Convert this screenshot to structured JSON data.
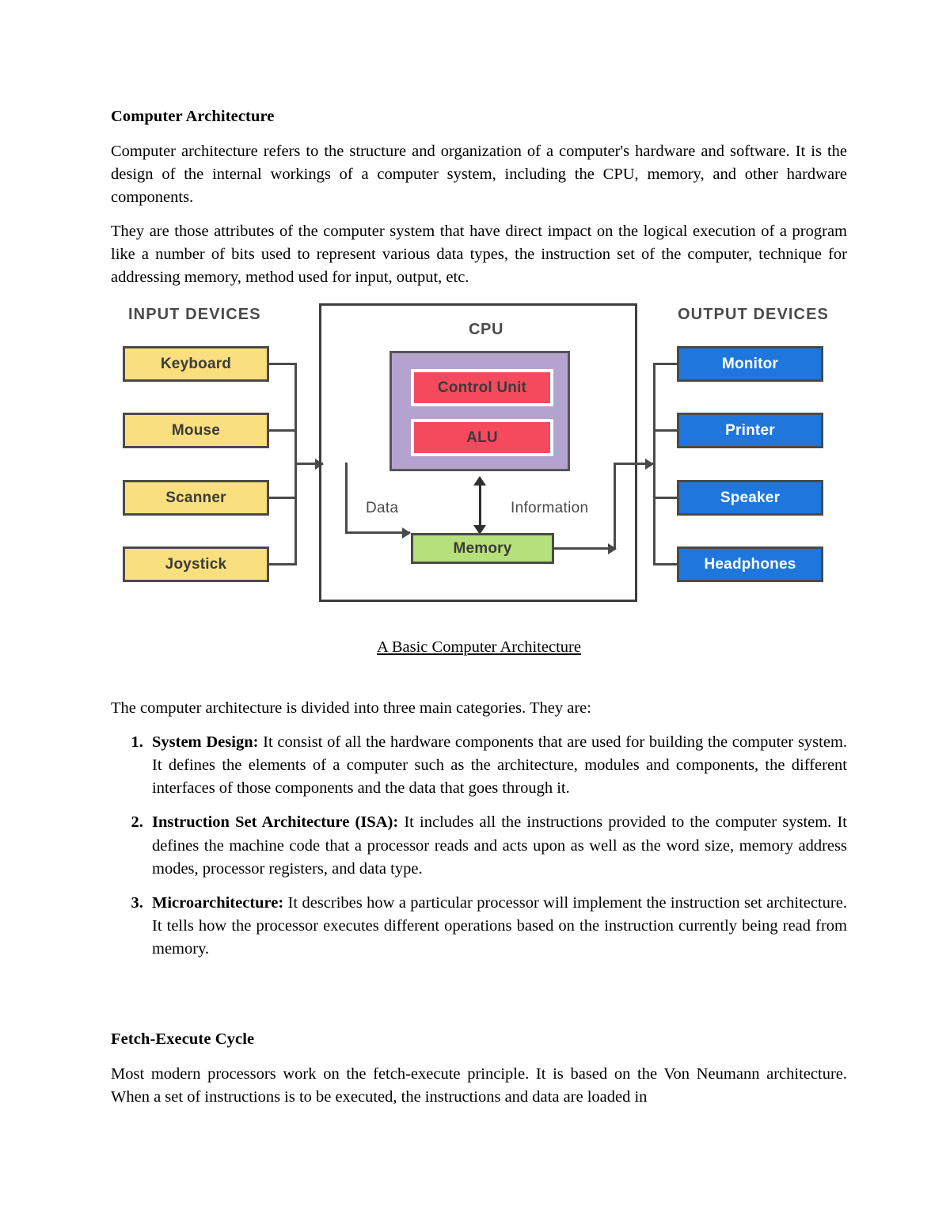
{
  "document": {
    "heading": "Computer Architecture",
    "paragraphs": [
      "Computer architecture refers to the structure and organization of a computer's hardware and software. It is the design of the internal workings of a computer system, including the CPU, memory, and other hardware components.",
      "They are those attributes of the computer system that have direct impact on the logical execution of a program like a number of bits used to represent various data types, the instruction set of the computer, technique for addressing memory, method used for input, output, etc."
    ],
    "figure_caption": "A Basic Computer Architecture",
    "list_intro": "The computer architecture is divided into three main categories. They are:",
    "categories": [
      {
        "term": "System Design:",
        "text": " It consist of all the hardware components that are used for building the computer system. It defines the elements of a computer such as the architecture, modules and components, the different interfaces of those components and the data that goes through it."
      },
      {
        "term": "Instruction Set Architecture (ISA):",
        "text": " It includes all the instructions provided to the computer system. It defines the machine code that a processor reads and acts upon as well as the word size, memory address modes, processor registers, and data type."
      },
      {
        "term": "Microarchitecture:",
        "text": " It describes how a particular processor will implement the instruction set architecture. It tells how the processor executes different operations based on the instruction currently being read from memory."
      }
    ],
    "section2_heading": "Fetch-Execute Cycle",
    "section2_paragraph": "Most modern processors work on the fetch-execute principle. It is based on the Von Neumann architecture.  When a set of instructions is to be executed, the instructions and data are loaded in"
  },
  "diagram": {
    "input_title": "INPUT DEVICES",
    "output_title": "OUTPUT DEVICES",
    "cpu_label": "CPU",
    "input_devices": [
      "Keyboard",
      "Mouse",
      "Scanner",
      "Joystick"
    ],
    "output_devices": [
      "Monitor",
      "Printer",
      "Speaker",
      "Headphones"
    ],
    "cpu_units": [
      "Control Unit",
      "ALU"
    ],
    "memory_label": "Memory",
    "flow_left_label": "Data",
    "flow_right_label": "Information",
    "colors": {
      "input_fill": "#FADF7F",
      "output_fill": "#1F77DD",
      "memory_fill": "#B6E07A",
      "cpu_fill": "#B4A3CE",
      "cpu_unit_fill": "#F54A5E",
      "stroke": "#4A4A4A"
    }
  }
}
